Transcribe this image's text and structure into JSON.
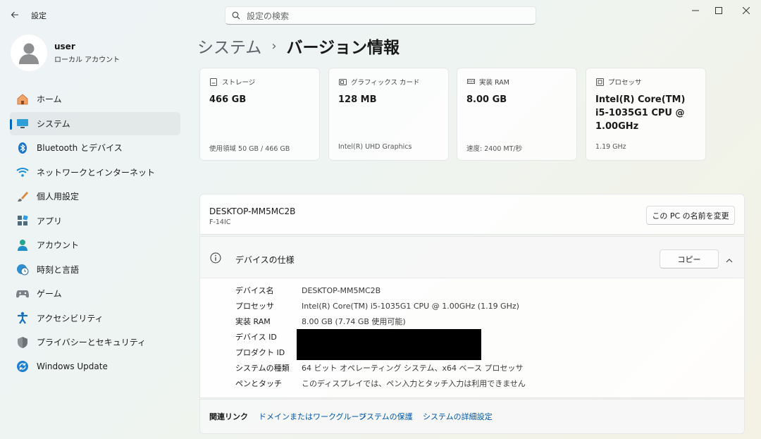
{
  "titlebar": {
    "app_title": "設定",
    "search_placeholder": "設定の検索"
  },
  "user": {
    "name": "user",
    "account_type": "ローカル アカウント"
  },
  "sidebar": {
    "items": [
      {
        "label": "ホーム",
        "icon": "home-icon"
      },
      {
        "label": "システム",
        "icon": "system-icon",
        "active": true
      },
      {
        "label": "Bluetooth とデバイス",
        "icon": "bluetooth-icon"
      },
      {
        "label": "ネットワークとインターネット",
        "icon": "wifi-icon"
      },
      {
        "label": "個人用設定",
        "icon": "brush-icon"
      },
      {
        "label": "アプリ",
        "icon": "apps-icon"
      },
      {
        "label": "アカウント",
        "icon": "person-icon"
      },
      {
        "label": "時刻と言語",
        "icon": "globe-clock-icon"
      },
      {
        "label": "ゲーム",
        "icon": "gamepad-icon"
      },
      {
        "label": "アクセシビリティ",
        "icon": "accessibility-icon"
      },
      {
        "label": "プライバシーとセキュリティ",
        "icon": "shield-icon"
      },
      {
        "label": "Windows Update",
        "icon": "update-icon"
      }
    ]
  },
  "breadcrumb": {
    "parent": "システム",
    "separator": "›",
    "current": "バージョン情報"
  },
  "cards": [
    {
      "label": "ストレージ",
      "value": "466 GB",
      "sub": "使用領域 50 GB / 466 GB"
    },
    {
      "label": "グラフィックス カード",
      "value": "128 MB",
      "sub": "Intel(R) UHD Graphics"
    },
    {
      "label": "実装 RAM",
      "value": "8.00 GB",
      "sub": "速度: 2400 MT/秒"
    },
    {
      "label": "プロセッサ",
      "value": "Intel(R) Core(TM) i5-1035G1 CPU @ 1.00GHz",
      "sub": "1.19 GHz"
    }
  ],
  "pc": {
    "name": "DESKTOP-MM5MC2B",
    "model": "F-14IC",
    "rename_button": "この PC の名前を変更"
  },
  "device_specs": {
    "title": "デバイスの仕様",
    "copy_button": "コピー",
    "rows": [
      {
        "key": "デバイス名",
        "value": "DESKTOP-MM5MC2B"
      },
      {
        "key": "プロセッサ",
        "value": "Intel(R) Core(TM) i5-1035G1 CPU @ 1.00GHz (1.19 GHz)"
      },
      {
        "key": "実装 RAM",
        "value": "8.00 GB (7.74 GB 使用可能)"
      },
      {
        "key": "デバイス ID",
        "value": ""
      },
      {
        "key": "プロダクト ID",
        "value": ""
      },
      {
        "key": "システムの種類",
        "value": "64 ビット オペレーティング システム、x64 ベース プロセッサ"
      },
      {
        "key": "ペンとタッチ",
        "value": "このディスプレイでは、ペン入力とタッチ入力は利用できません"
      }
    ]
  },
  "related_links": {
    "label": "関連リンク",
    "links": [
      "ドメインまたはワークグループ",
      "システムの保護",
      "システムの詳細設定"
    ]
  }
}
